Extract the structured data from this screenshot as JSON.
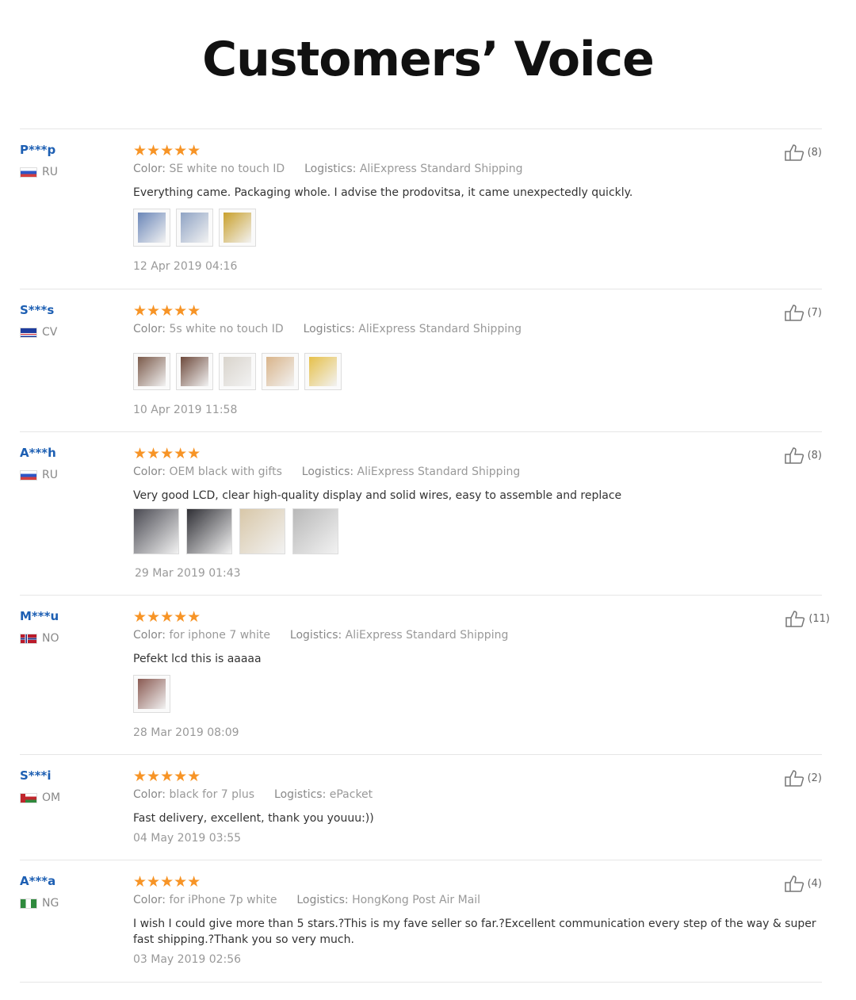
{
  "page_title": "Customers’ Voice",
  "labels": {
    "color": "Color:",
    "logistics": "Logistics:"
  },
  "reviews": [
    {
      "user": "P***p",
      "country": "RU",
      "flag": "ru",
      "stars": "★★★★★",
      "color": "SE white no touch ID",
      "logistics": "AliExpress Standard Shipping",
      "text": "Everything came. Packaging whole. I advise the prodovitsa, it came unexpectedly quickly.",
      "date": "12 Apr 2019 04:16",
      "likes": "(8)",
      "photos": [
        "#6a86b8",
        "#8fa3c4",
        "#c9a02b"
      ]
    },
    {
      "user": "S***s",
      "country": "CV",
      "flag": "cv",
      "stars": "★★★★★",
      "color": "5s white no touch ID",
      "logistics": "AliExpress Standard Shipping",
      "text": "",
      "date": "10 Apr 2019 11:58",
      "likes": "(7)",
      "photos": [
        "#7b5a4a",
        "#6e4a3c",
        "#d9d4cc",
        "#d9b48a",
        "#e6c04a"
      ]
    },
    {
      "user": "A***h",
      "country": "RU",
      "flag": "ru",
      "stars": "★★★★★",
      "color": "OEM black with gifts",
      "logistics": "AliExpress Standard Shipping",
      "text": "Very good LCD, clear high-quality display and solid wires, easy to assemble and replace",
      "date": "29 Mar 2019 01:43",
      "likes": "(8)",
      "photos": [
        "#4a4a52",
        "#2f2f35",
        "#d8c7a8",
        "#b8b8b8"
      ]
    },
    {
      "user": "M***u",
      "country": "NO",
      "flag": "no",
      "stars": "★★★★★",
      "color": "for iphone 7 white",
      "logistics": "AliExpress Standard Shipping",
      "text": "Pefekt lcd this is aaaaa",
      "date": "28 Mar 2019 08:09",
      "likes": "(11)",
      "photos": [
        "#8a5a52"
      ]
    },
    {
      "user": "S***i",
      "country": "OM",
      "flag": "om",
      "stars": "★★★★★",
      "color": "black for 7 plus",
      "logistics": "ePacket",
      "text": "Fast delivery, excellent, thank you youuu:))",
      "date": "04 May 2019 03:55",
      "likes": "(2)",
      "photos": []
    },
    {
      "user": "A***a",
      "country": "NG",
      "flag": "ng",
      "stars": "★★★★★",
      "color": "for iPhone 7p white",
      "logistics": "HongKong Post Air Mail",
      "text": "I wish I could give more than 5 stars.?This is my fave seller so far.?Excellent communication every step of the way & super fast shipping.?Thank you so very much.",
      "date": "03 May 2019 02:56",
      "likes": "(4)",
      "photos": []
    }
  ]
}
